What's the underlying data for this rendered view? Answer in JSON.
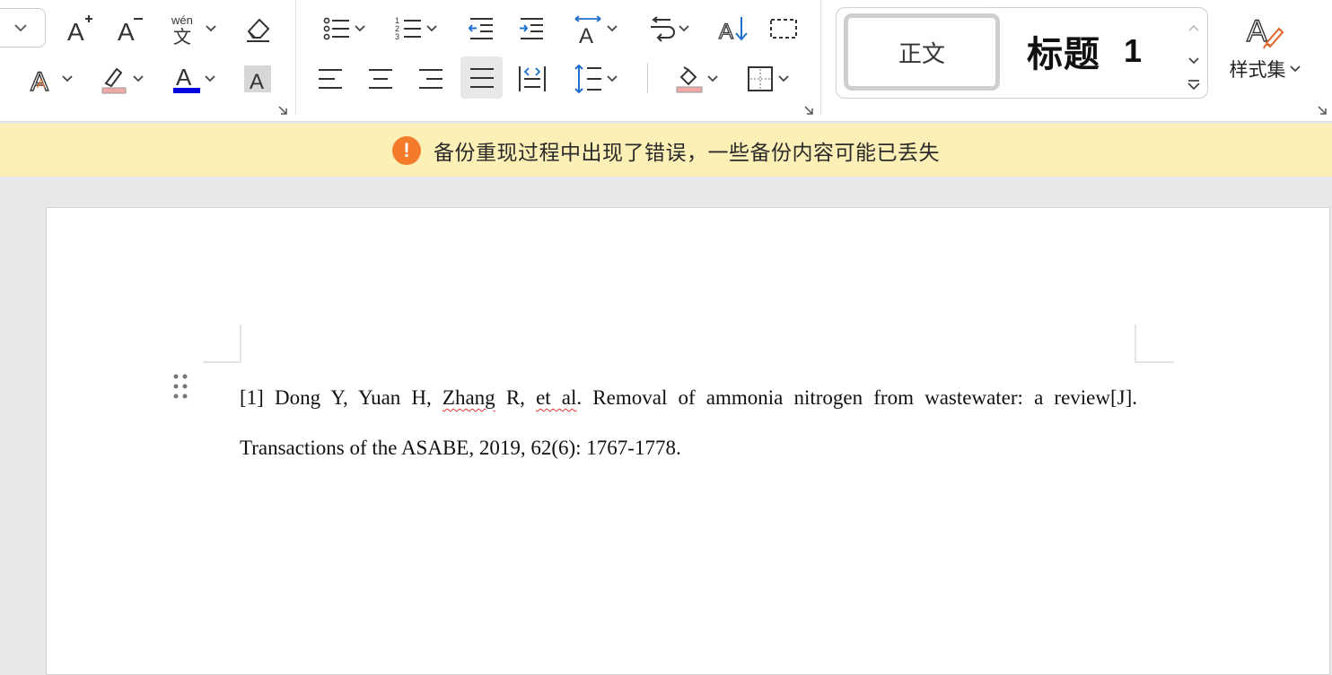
{
  "ribbon": {
    "styles": {
      "normal_label": "正文",
      "heading_label": "标题",
      "heading_number": "1",
      "style_set_label": "样式集"
    },
    "font_group_icons": [
      "font-name-dropdown-icon",
      "grow-font-icon",
      "shrink-font-icon",
      "phonetic-guide-icon",
      "clear-format-icon",
      "text-effect-icon",
      "highlight-icon",
      "font-color-icon",
      "character-shading-icon"
    ],
    "paragraph_group_icons": [
      "bullets-icon",
      "numbering-icon",
      "decrease-indent-icon",
      "increase-indent-icon",
      "text-direction-icon",
      "sort-icon",
      "align-left-icon",
      "align-center-icon",
      "align-right-icon",
      "justify-icon",
      "distributed-icon",
      "line-spacing-icon",
      "shading-icon",
      "borders-icon",
      "chinese-layout-icon",
      "show-marks-icon"
    ],
    "colors": {
      "font_color": "#0000e0",
      "highlight": "#f3a8a8",
      "justify_active_bg": "#e8e8e8"
    }
  },
  "notice": {
    "message": "备份重现过程中出现了错误，一些备份内容可能已丢失",
    "icon": "!",
    "color": "#f47b2a",
    "background": "#fdf0b7"
  },
  "document": {
    "ref_part1": "[1] Dong Y, Yuan H, ",
    "ref_zhang": "Zhang",
    "ref_part2": " R, ",
    "ref_etal": "et al",
    "ref_part3": ". Removal of ammonia nitrogen from wastewater: a review[J]. Transactions of the ASABE, 2019, 62(6): 1767-1778."
  }
}
